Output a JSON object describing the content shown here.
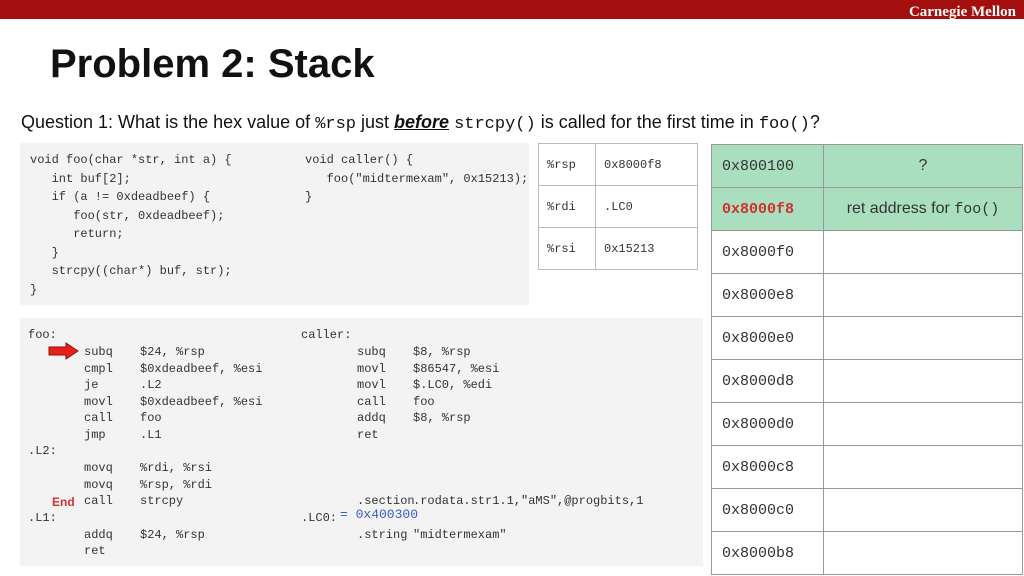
{
  "header": {
    "brand": "Carnegie Mellon"
  },
  "slide": {
    "title": "Problem 2: Stack"
  },
  "question": {
    "prefix": "Question 1: What is the hex value of",
    "reg": "%rsp",
    "word1": "just",
    "emph": "before",
    "func": "strcpy()",
    "mid": "is called for the first time in",
    "func2": "foo()",
    "suffix": "?"
  },
  "c_code": {
    "foo": "void foo(char *str, int a) {\n   int buf[2];\n   if (a != 0xdeadbeef) {\n      foo(str, 0xdeadbeef);\n      return;\n   }\n   strcpy((char*) buf, str);\n}",
    "caller": "void caller() {\n   foo(\"midtermexam\", 0x15213);\n}"
  },
  "asm": {
    "foo_labels": "foo:\n\n\n\n\n\n\n.L2:\n\n\n\n.L1:\n",
    "foo_ops": "subq\ncmpl\nje\nmovl\ncall\njmp\n\nmovq\nmovq\ncall\n\naddq\nret",
    "foo_args": "$24, %rsp\n$0xdeadbeef, %esi\n.L2\n$0xdeadbeef, %esi\nfoo\n.L1\n\n%rdi, %rsi\n%rsp, %rdi\nstrcpy\n\n$24, %rsp\n",
    "caller_labels": "caller:\n\n\n\n\n\n\n\n\n\n\n.LC0:",
    "caller_ops": "subq\nmovl\nmovl\ncall\naddq\nret\n\n\n\n.section\n\n.string",
    "caller_args": "$8, %rsp\n$86547, %esi\n$.LC0, %edi\nfoo\n$8, %rsp\n\n\n\n\n.rodata.str1.1,\"aMS\",@progbits,1\n\n\"midtermexam\"",
    "end_label": "End",
    "lc0_note": "= 0x400300"
  },
  "registers": [
    {
      "name": "%rsp",
      "value": "0x8000f8"
    },
    {
      "name": "%rdi",
      "value": ".LC0"
    },
    {
      "name": "%rsi",
      "value": "0x15213"
    }
  ],
  "stack": [
    {
      "addr": "0x800100",
      "content": "?"
    },
    {
      "addr": "0x8000f8",
      "content": "ret address for",
      "content_code": "foo()"
    },
    {
      "addr": "0x8000f0",
      "content": ""
    },
    {
      "addr": "0x8000e8",
      "content": ""
    },
    {
      "addr": "0x8000e0",
      "content": ""
    },
    {
      "addr": "0x8000d8",
      "content": ""
    },
    {
      "addr": "0x8000d0",
      "content": ""
    },
    {
      "addr": "0x8000c8",
      "content": ""
    },
    {
      "addr": "0x8000c0",
      "content": ""
    },
    {
      "addr": "0x8000b8",
      "content": ""
    }
  ],
  "colors": {
    "top_bar": "#a30f0f",
    "highlight_red": "#d03030",
    "stack_fill": "#a9dfbf",
    "code_bg": "#f3f3f3",
    "note_blue": "#3a5bc7"
  }
}
